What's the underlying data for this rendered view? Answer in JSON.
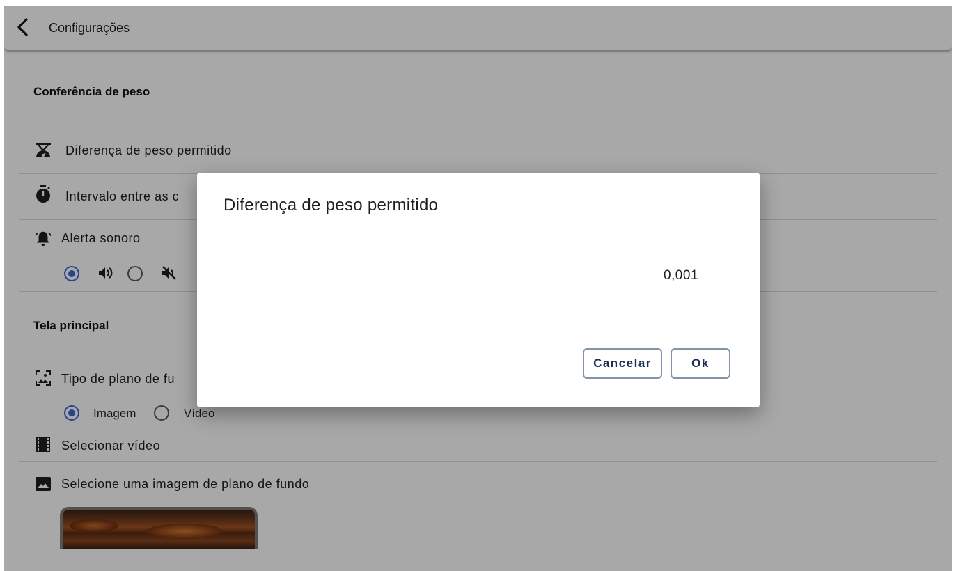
{
  "appbar": {
    "back_icon": "chevron-left-icon",
    "title": "Configurações"
  },
  "weight_section": {
    "title": "Conferência de peso",
    "items": [
      {
        "icon": "scale-icon",
        "label": "Diferença de peso permitido"
      },
      {
        "icon": "timer-icon",
        "label": "Intervalo entre as c"
      },
      {
        "icon": "alarm-bell-icon",
        "label": "Alerta sonoro"
      }
    ],
    "sound_options": [
      {
        "icon": "volume-up-icon",
        "selected": true
      },
      {
        "icon": "volume-off-icon",
        "selected": false
      }
    ]
  },
  "main_screen_section": {
    "title": "Tela principal",
    "background_type": {
      "icon": "wallpaper-icon",
      "label": "Tipo de plano de fu",
      "options": [
        {
          "label": "Imagem",
          "selected": true
        },
        {
          "label": "Vídeo",
          "selected": false
        }
      ]
    },
    "select_video": {
      "icon": "film-icon",
      "label": "Selecionar vídeo"
    },
    "select_image": {
      "icon": "image-icon",
      "label": "Selecione uma imagem de plano de fundo"
    }
  },
  "dialog": {
    "title": "Diferença de peso permitido",
    "value": "0,001",
    "cancel_label": "Cancelar",
    "ok_label": "Ok"
  },
  "colors": {
    "accent": "#3f64d8",
    "button_text": "#1e2f55",
    "button_border": "#8393a8",
    "scrim": "rgba(0,0,0,0.34)"
  }
}
